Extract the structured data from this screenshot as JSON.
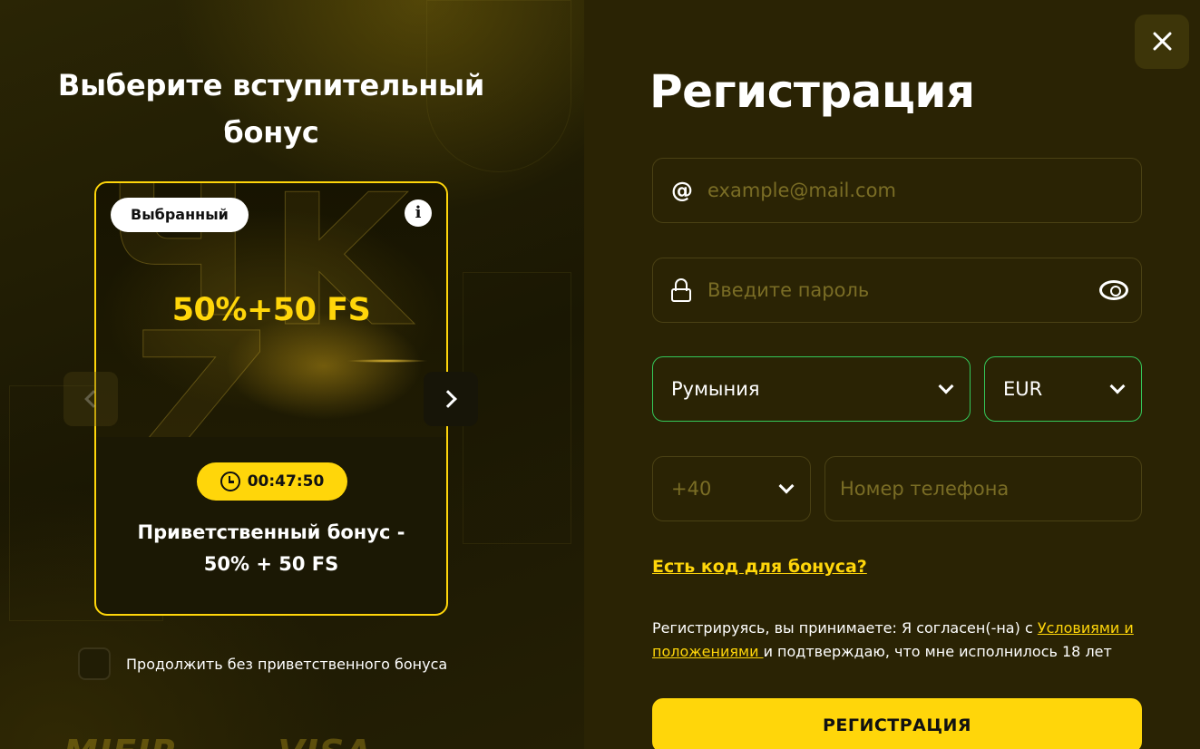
{
  "bonus_panel": {
    "title": "Выберите вступительный бонус",
    "card": {
      "badge": "Выбранный",
      "info_icon": "i",
      "offer": "50%+50 FS",
      "timer": "00:47:50",
      "title": "Приветственный бонус - 50% + 50 FS"
    },
    "no_bonus_label": "Продолжить без приветственного бонуса",
    "payment_logos": [
      "MIFIR",
      "VISA"
    ]
  },
  "registration": {
    "title": "Регистрация",
    "email": {
      "placeholder": "example@mail.com",
      "value": ""
    },
    "password": {
      "placeholder": "Введите пароль",
      "value": ""
    },
    "country": {
      "selected": "Румыния"
    },
    "currency": {
      "selected": "EUR"
    },
    "phone_code": {
      "selected": "+40"
    },
    "phone": {
      "placeholder": "Номер телефона",
      "value": ""
    },
    "promo_link": "Есть код для бонуса?",
    "terms": {
      "prefix": "Регистрируясь, вы принимаете: Я согласен(-на) с ",
      "link": "Условиями и положениями ",
      "suffix": "и подтверждаю, что мне исполнилось 18 лет"
    },
    "submit_label": "РЕГИСТРАЦИЯ"
  },
  "colors": {
    "accent": "#ffd60a",
    "valid_border": "#34c759",
    "panel_bg": "#2a2304"
  },
  "icons": [
    "at-icon",
    "lock-icon",
    "eye-icon",
    "clock-icon",
    "info-icon",
    "close-icon",
    "chevron-left-icon",
    "chevron-right-icon",
    "chevron-down-icon"
  ]
}
